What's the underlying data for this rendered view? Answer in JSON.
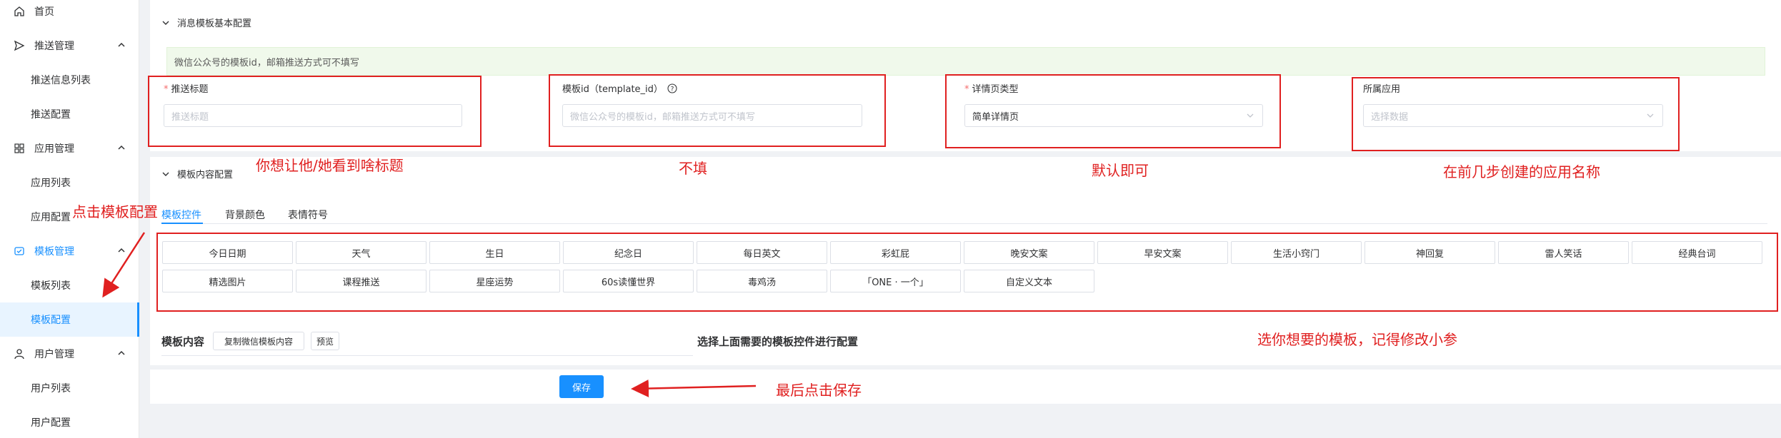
{
  "sidebar": {
    "home": "首页",
    "push_mgmt": "推送管理",
    "push_list": "推送信息列表",
    "push_config": "推送配置",
    "app_mgmt": "应用管理",
    "app_list": "应用列表",
    "app_config": "应用配置",
    "template_mgmt": "模板管理",
    "template_list": "模板列表",
    "template_config": "模板配置",
    "user_mgmt": "用户管理",
    "user_list": "用户列表",
    "user_config": "用户配置"
  },
  "basic": {
    "section_title": "消息模板基本配置",
    "alert": "微信公众号的模板id，邮箱推送方式可不填写",
    "title_label": "推送标题",
    "title_placeholder": "推送标题",
    "template_id_label": "模板id（template_id）",
    "template_id_placeholder": "微信公众号的模板id，邮箱推送方式可不填写",
    "detail_type_label": "详情页类型",
    "detail_type_value": "简单详情页",
    "app_label": "所属应用",
    "app_placeholder": "选择数据"
  },
  "content": {
    "section_title": "模板内容配置",
    "tabs": [
      "模板控件",
      "背景颜色",
      "表情符号"
    ],
    "controls_row1": [
      "今日日期",
      "天气",
      "生日",
      "纪念日",
      "每日英文",
      "彩虹屁",
      "晚安文案",
      "早安文案",
      "生活小窍门",
      "神回复",
      "雷人笑话",
      "经典台词"
    ],
    "controls_row2": [
      "精选图片",
      "课程推送",
      "星座运势",
      "60s读懂世界",
      "毒鸡汤",
      "「ONE · 一个」",
      "自定义文本"
    ],
    "template_content_label": "模板内容",
    "copy_button": "复制微信模板内容",
    "preview_button": "预览",
    "config_hint": "选择上面需要的模板控件进行配置",
    "save_button": "保存"
  },
  "annotations": {
    "title_note": "你想让他/她看到啥标题",
    "template_id_note": "不填",
    "detail_note": "默认即可",
    "app_note": "在前几步创建的应用名称",
    "click_config_note": "点击模板配置",
    "choose_note": "选你想要的模板，记得修改小参",
    "save_note": "最后点击保存"
  },
  "colors": {
    "accent": "#1890ff",
    "annotation": "#e02020",
    "alert_bg": "#f0f9eb"
  }
}
